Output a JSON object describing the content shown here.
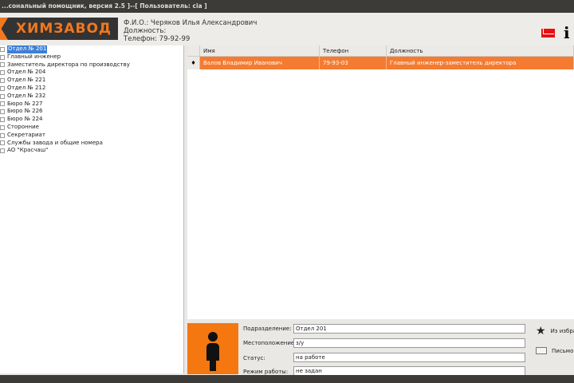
{
  "title": "...сональный помощник, версия 2.5 ]--[ Пользователь: cia ]",
  "logo": "ХИМЗАВОД",
  "user": {
    "fio": "Ф.И.О.: Черяков Илья Александрович",
    "position": "Должность:",
    "phone": "Телефон: 79-92-99"
  },
  "tree": [
    "Отдел № 201",
    "Главный инженер",
    "Заместитель директора по производству",
    "Отдел № 204",
    "Отдел № 221",
    "Отдел № 212",
    "Отдел № 232",
    "Бюро № 227",
    "Бюро № 226",
    "Бюро № 224",
    "Сторонние",
    "Секретариат",
    "Службы завода и общие номера",
    "АО \"Красчаш\""
  ],
  "grid": {
    "columns": [
      "Имя",
      "Телефон",
      "Должность"
    ],
    "rows": [
      {
        "name": "Валов Владимир Иванович",
        "phone": "79-93-03",
        "position": "Главный инженер-заместитель директора"
      }
    ]
  },
  "details": {
    "labels": [
      "Подразделение:",
      "Местоположение:",
      "Статус:",
      "Режим работы:"
    ],
    "values": [
      "Отдел 201",
      "з/у",
      "на работе",
      "не задан"
    ],
    "favorite": "Из избра",
    "letter": "Письмо"
  },
  "colors": {
    "accent": "#f47b30",
    "selection": "#3d7fd6"
  }
}
